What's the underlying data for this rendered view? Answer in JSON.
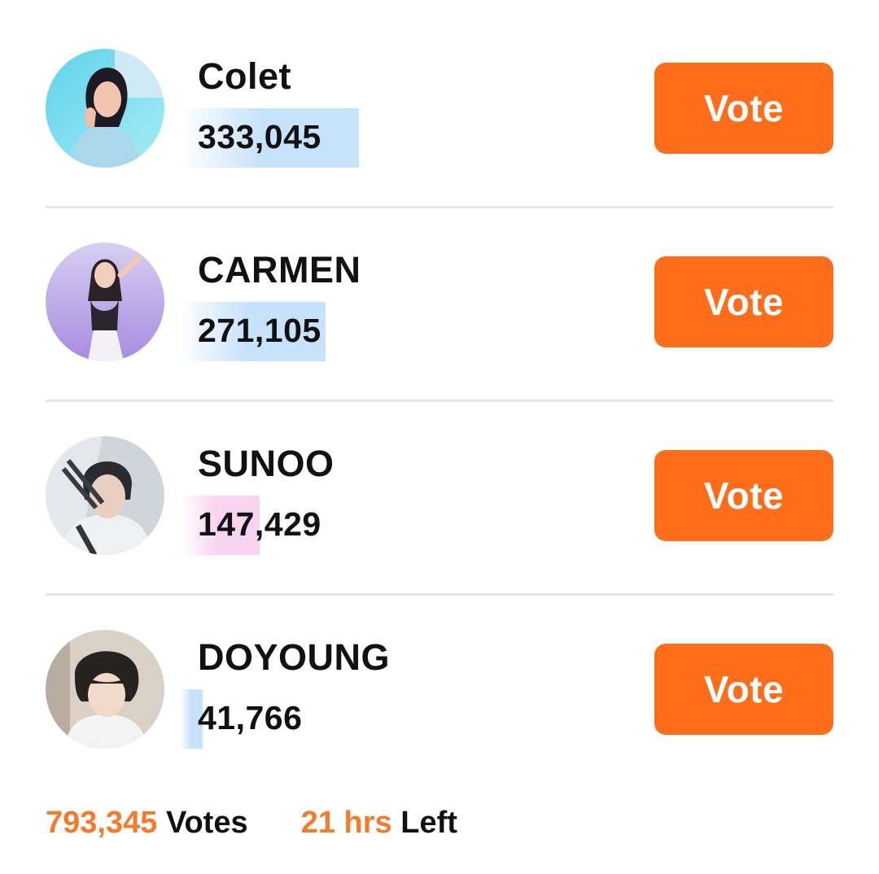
{
  "candidates": [
    {
      "name": "Colet",
      "votes": "333,045",
      "vote_share": 0.4198,
      "bar_color": "#c7e2fb",
      "avatar_icon": "avatar-photo",
      "vote_label": "Vote"
    },
    {
      "name": "CARMEN",
      "votes": "271,105",
      "vote_share": 0.3417,
      "bar_color": "#c7e2fb",
      "avatar_icon": "avatar-photo",
      "vote_label": "Vote"
    },
    {
      "name": "SUNOO",
      "votes": "147,429",
      "vote_share": 0.1858,
      "bar_color": "#f9d4f1",
      "avatar_icon": "avatar-photo",
      "vote_label": "Vote"
    },
    {
      "name": "DOYOUNG",
      "votes": "41,766",
      "vote_share": 0.0526,
      "bar_color": "#c7e2fb",
      "avatar_icon": "avatar-photo",
      "vote_label": "Vote"
    }
  ],
  "footer": {
    "total_votes": "793,345",
    "votes_label": "Votes",
    "time_left": "21 hrs",
    "left_label": "Left"
  },
  "colors": {
    "accent": "#fe6d1a",
    "footer_accent": "#f57a2a",
    "divider": "#e6e6e6"
  }
}
